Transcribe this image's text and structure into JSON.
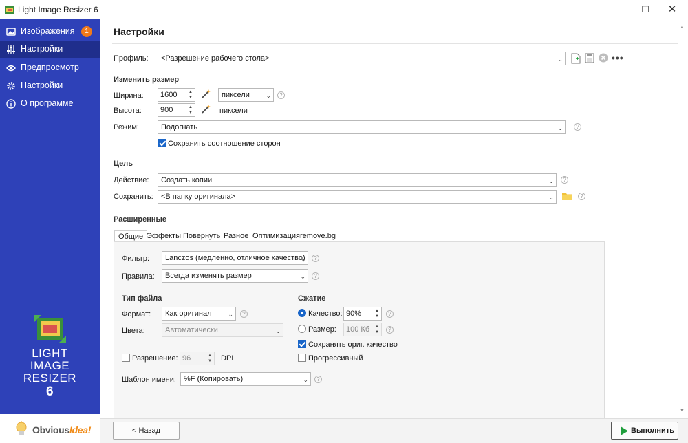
{
  "window": {
    "title": "Light Image Resizer 6"
  },
  "sidebar": {
    "items": [
      {
        "label": "Изображения",
        "badge": "1"
      },
      {
        "label": "Настройки"
      },
      {
        "label": "Предпросмотр"
      },
      {
        "label": "Настройки"
      },
      {
        "label": "О программе"
      }
    ],
    "brand_line1": "LIGHT",
    "brand_line2": "IMAGE",
    "brand_line3": "RESIZER",
    "brand_version": "6",
    "company_part1": "Obvious",
    "company_part2": "Idea!"
  },
  "page": {
    "title": "Настройки"
  },
  "profile": {
    "label": "Профиль:",
    "value": "<Разрешение рабочего стола>"
  },
  "resize": {
    "section": "Изменить размер",
    "width_label": "Ширина:",
    "width_value": "1600",
    "width_unit": "пиксели",
    "height_label": "Высота:",
    "height_value": "900",
    "height_unit": "пиксели",
    "mode_label": "Режим:",
    "mode_value": "Подогнать",
    "keep_ratio_label": "Сохранить соотношение сторон"
  },
  "target": {
    "section": "Цель",
    "action_label": "Действие:",
    "action_value": "Создать копии",
    "save_label": "Сохранить:",
    "save_value": "<В папку оригинала>"
  },
  "advanced": {
    "section": "Расширенные",
    "tabs": [
      "Общие",
      "Эффекты",
      "Повернуть",
      "Разное",
      "Оптимизация",
      "remove.bg"
    ],
    "filter_label": "Фильтр:",
    "filter_value": "Lanczos  (медленно, отличное качество)",
    "rules_label": "Правила:",
    "rules_value": "Всегда изменять размер",
    "filetype_section": "Тип файла",
    "format_label": "Формат:",
    "format_value": "Как оригинал",
    "colors_label": "Цвета:",
    "colors_value": "Автоматически",
    "resolution_label": "Разрешение:",
    "resolution_value": "96",
    "resolution_unit": "DPI",
    "name_template_label": "Шаблон имени:",
    "name_template_value": "%F (Копировать)",
    "compression_section": "Сжатие",
    "quality_label": "Качество:",
    "quality_value": "90%",
    "size_label": "Размер:",
    "size_value": "100 Кб",
    "keep_quality_label": "Сохранять ориг. качество",
    "progressive_label": "Прогрессивный"
  },
  "footer": {
    "back_label": "< Назад",
    "run_label": "Выполнить"
  },
  "colors": {
    "sidebar": "#2e41b8",
    "sidebar_active": "#1f2e8c",
    "accent": "#1a66c9",
    "badge": "#f07a1a",
    "run_icon": "#1f9e3c"
  }
}
